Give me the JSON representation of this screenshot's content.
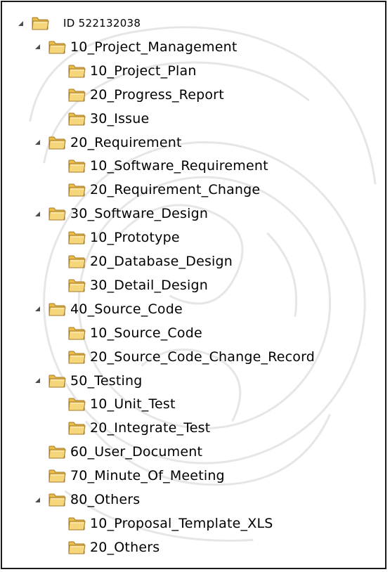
{
  "colors": {
    "folder_body": "#f5d67a",
    "folder_outline": "#a5782a",
    "folder_tab": "#e9bd4a",
    "expander": "#4d4d4d",
    "text": "#000000",
    "border": "#1a1a1a"
  },
  "icons": {
    "expander": "triangle-down-expanded-icon",
    "folder": "folder-icon"
  },
  "tree": [
    {
      "label": "ID 522132038",
      "level": 0,
      "expanded": true
    },
    {
      "label": "10_Project_Management",
      "level": 1,
      "expanded": true
    },
    {
      "label": "10_Project_Plan",
      "level": 2,
      "expanded": null
    },
    {
      "label": "20_Progress_Report",
      "level": 2,
      "expanded": null
    },
    {
      "label": "30_Issue",
      "level": 2,
      "expanded": null
    },
    {
      "label": "20_Requirement",
      "level": 1,
      "expanded": true
    },
    {
      "label": "10_Software_Requirement",
      "level": 2,
      "expanded": null
    },
    {
      "label": "20_Requirement_Change",
      "level": 2,
      "expanded": null
    },
    {
      "label": "30_Software_Design",
      "level": 1,
      "expanded": true
    },
    {
      "label": "10_Prototype",
      "level": 2,
      "expanded": null
    },
    {
      "label": "20_Database_Design",
      "level": 2,
      "expanded": null
    },
    {
      "label": "30_Detail_Design",
      "level": 2,
      "expanded": null
    },
    {
      "label": "40_Source_Code",
      "level": 1,
      "expanded": true
    },
    {
      "label": "10_Source_Code",
      "level": 2,
      "expanded": null
    },
    {
      "label": "20_Source_Code_Change_Record",
      "level": 2,
      "expanded": null
    },
    {
      "label": "50_Testing",
      "level": 1,
      "expanded": true
    },
    {
      "label": "10_Unit_Test",
      "level": 2,
      "expanded": null
    },
    {
      "label": "20_Integrate_Test",
      "level": 2,
      "expanded": null
    },
    {
      "label": "60_User_Document",
      "level": 1,
      "expanded": null
    },
    {
      "label": "70_Minute_Of_Meeting",
      "level": 1,
      "expanded": null
    },
    {
      "label": "80_Others",
      "level": 1,
      "expanded": true
    },
    {
      "label": "10_Proposal_Template_XLS",
      "level": 2,
      "expanded": null
    },
    {
      "label": "20_Others",
      "level": 2,
      "expanded": null
    }
  ]
}
